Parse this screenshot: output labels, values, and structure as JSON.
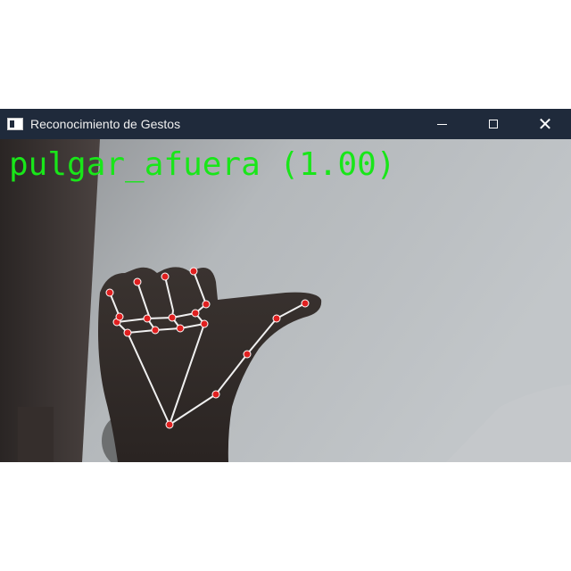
{
  "window": {
    "title": "Reconocimiento de Gestos",
    "icon": "app-window-icon",
    "controls": [
      "minimize-icon",
      "maximize-icon",
      "close-icon"
    ]
  },
  "video": {
    "gesture_label": "pulgar_afuera (1.00)",
    "label_color": "#19e619",
    "landmark_color": "#e02020",
    "connection_color": "#f0f0f0"
  }
}
